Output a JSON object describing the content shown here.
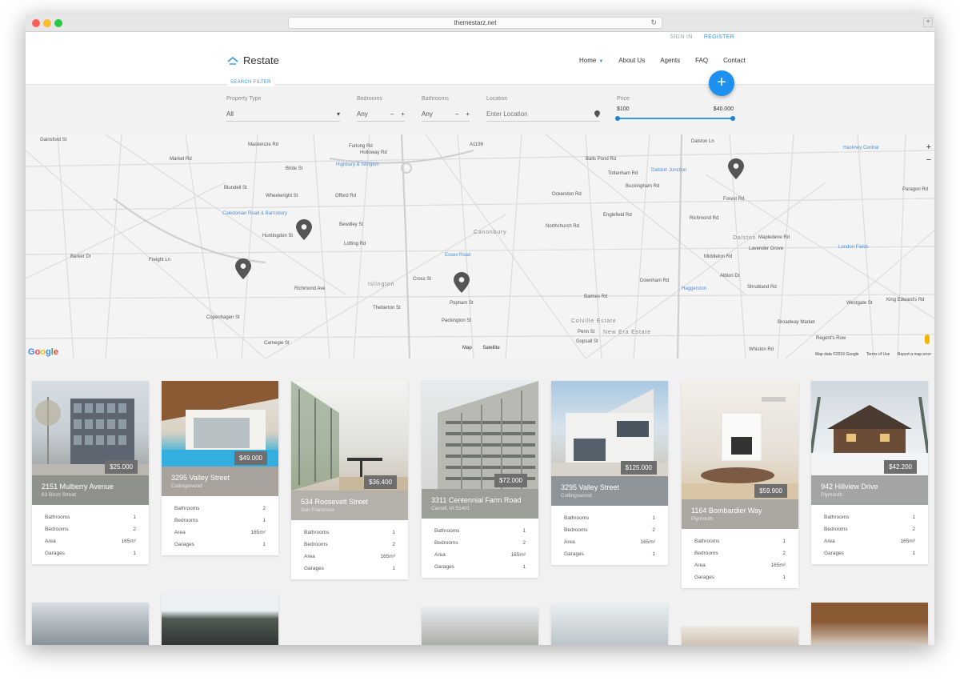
{
  "browser": {
    "url": "themestarz.net",
    "newtab": "+"
  },
  "header": {
    "signin": "SIGN IN",
    "register": "REGISTER",
    "logo": "Restate",
    "nav": [
      "Home",
      "About Us",
      "Agents",
      "FAQ",
      "Contact"
    ],
    "add_button": "+"
  },
  "filter": {
    "tab": "SEARCH FILTER",
    "property_type_label": "Property Type",
    "property_type_value": "All",
    "bedrooms_label": "Bedrooms",
    "bedrooms_value": "Any",
    "bathrooms_label": "Bathrooms",
    "bathrooms_value": "Any",
    "location_label": "Location",
    "location_placeholder": "Enter Location",
    "price_label": "Price",
    "price_min": "$100",
    "price_max": "$40.000",
    "minus": "–",
    "plus": "+",
    "caret": "▾"
  },
  "map": {
    "streets": [
      "Gainsford St",
      "Mackenzie Rd",
      "Bride St",
      "Furlong Rd",
      "Holloway Rd",
      "A1199",
      "Balls Pond Rd",
      "Dalston Ln",
      "Hackney Central",
      "Market Rd",
      "Blundell St",
      "Wheelwright St",
      "Offord Rd",
      "Highbury & Islington",
      "Canonbury",
      "Tottenham Rd",
      "Buckingham Rd",
      "Dalston Junction",
      "Ockendon Rd",
      "Englefield Rd",
      "Forest Rd",
      "Paragon Rd",
      "Caledonian Road & Barnsbury",
      "Bewdley St",
      "Northchurch Rd",
      "Richmond Rd",
      "Dalston",
      "Mapledene Rd",
      "Lavender Grove",
      "Essex Road",
      "London Fields",
      "Barker Dr",
      "Freight Ln",
      "Huntingdon St",
      "Lofting Rd",
      "Middleton Rd",
      "Albion Dr",
      "Richmond Ave",
      "Islington",
      "Cross St",
      "Shrubland Rd",
      "Haggerston",
      "Downham Rd",
      "Theberton St",
      "Popham St",
      "Balmes Rd",
      "Colville Estate",
      "Westgate St",
      "King Edward's Rd",
      "Copenhagen St",
      "Packington St",
      "New Era Estate",
      "Penn St",
      "Broadway Market",
      "Carnegie St",
      "Gopsall St",
      "Whiston Rd",
      "Regent's Row"
    ],
    "zoom_in": "+",
    "zoom_out": "−",
    "map_type_map": "Map",
    "map_type_satellite": "Satellite",
    "attribution": "Map data ©2016 Google",
    "terms": "Terms of Use",
    "report": "Report a map error",
    "google": [
      "G",
      "o",
      "o",
      "g",
      "l",
      "e"
    ]
  },
  "properties": [
    {
      "title": "2151 Mulberry Avenue",
      "sub": "63 Birch Street",
      "price": "$25.000",
      "bath": "1",
      "bed": "2",
      "area": "165m²",
      "garages": "1",
      "color": "#8e918c"
    },
    {
      "title": "3295 Valley Street",
      "sub": "Collingswood",
      "price": "$49.000",
      "bath": "2",
      "bed": "1",
      "area": "165m²",
      "garages": "1",
      "color": "#a7a39c"
    },
    {
      "title": "534 Roosevelt Street",
      "sub": "San Francisco",
      "price": "$36.400",
      "bath": "1",
      "bed": "2",
      "area": "165m²",
      "garages": "1",
      "color": "#b3b1aa"
    },
    {
      "title": "3311 Centennial Farm Road",
      "sub": "Carroll, IA 51401",
      "price": "$72.000",
      "bath": "1",
      "bed": "2",
      "area": "165m²",
      "garages": "1",
      "color": "#9c9f97"
    },
    {
      "title": "3295 Valley Street",
      "sub": "Collingswood",
      "price": "$125.000",
      "bath": "1",
      "bed": "2",
      "area": "165m²",
      "garages": "1",
      "color": "#8f9499"
    },
    {
      "title": "1164 Bombardier Way",
      "sub": "Plymouth",
      "price": "$59.900",
      "bath": "1",
      "bed": "2",
      "area": "165m²",
      "garages": "1",
      "color": "#aba8a2"
    },
    {
      "title": "942 Hillview Drive",
      "sub": "Plymouth",
      "price": "$42.200",
      "bath": "1",
      "bed": "2",
      "area": "165m²",
      "garages": "1",
      "color": "#a3a5a4"
    }
  ],
  "labels": {
    "bathrooms": "Bathrooms",
    "bedrooms": "Bedrooms",
    "area": "Area",
    "garages": "Garages"
  },
  "colors": {
    "accent": "#2d9ae8",
    "fab": "#1e90f0"
  }
}
